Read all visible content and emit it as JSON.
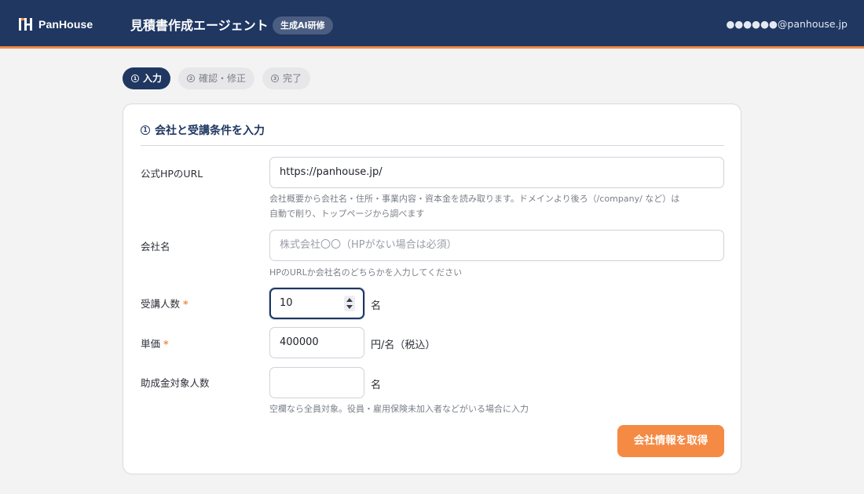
{
  "header": {
    "logo_text": "PanHouse",
    "title": "見積書作成エージェント",
    "badge": "生成AI研修",
    "user_email": "●●●●●●@panhouse.jp",
    "colors": {
      "bar": "#1f3761",
      "accent": "#f58a45"
    }
  },
  "steps": [
    {
      "num": "1",
      "label": "入力",
      "active": true
    },
    {
      "num": "2",
      "label": "確認・修正",
      "active": false
    },
    {
      "num": "3",
      "label": "完了",
      "active": false
    }
  ],
  "form": {
    "section_num": "1",
    "section_title": "会社と受講条件を入力",
    "url": {
      "label": "公式HPのURL",
      "value": "https://panhouse.jp/",
      "help_line1": "会社概要から会社名・住所・事業内容・資本金を読み取ります。ドメインより後ろ（/company/ など）は",
      "help_line2": "自動で削り、トップページから調べます"
    },
    "company": {
      "label": "会社名",
      "value": "",
      "placeholder": "株式会社〇〇（HPがない場合は必須）",
      "help": "HPのURLか会社名のどちらかを入力してください"
    },
    "attendees": {
      "label": "受講人数",
      "required_mark": "*",
      "value": "10",
      "unit": "名"
    },
    "unit_price": {
      "label": "単価",
      "required_mark": "*",
      "value": "400000",
      "unit": "円/名（税込）"
    },
    "subsidy": {
      "label": "助成金対象人数",
      "value": "",
      "unit": "名",
      "help": "空欄なら全員対象。役員・雇用保険未加入者などがいる場合に入力"
    },
    "submit_label": "会社情報を取得"
  }
}
